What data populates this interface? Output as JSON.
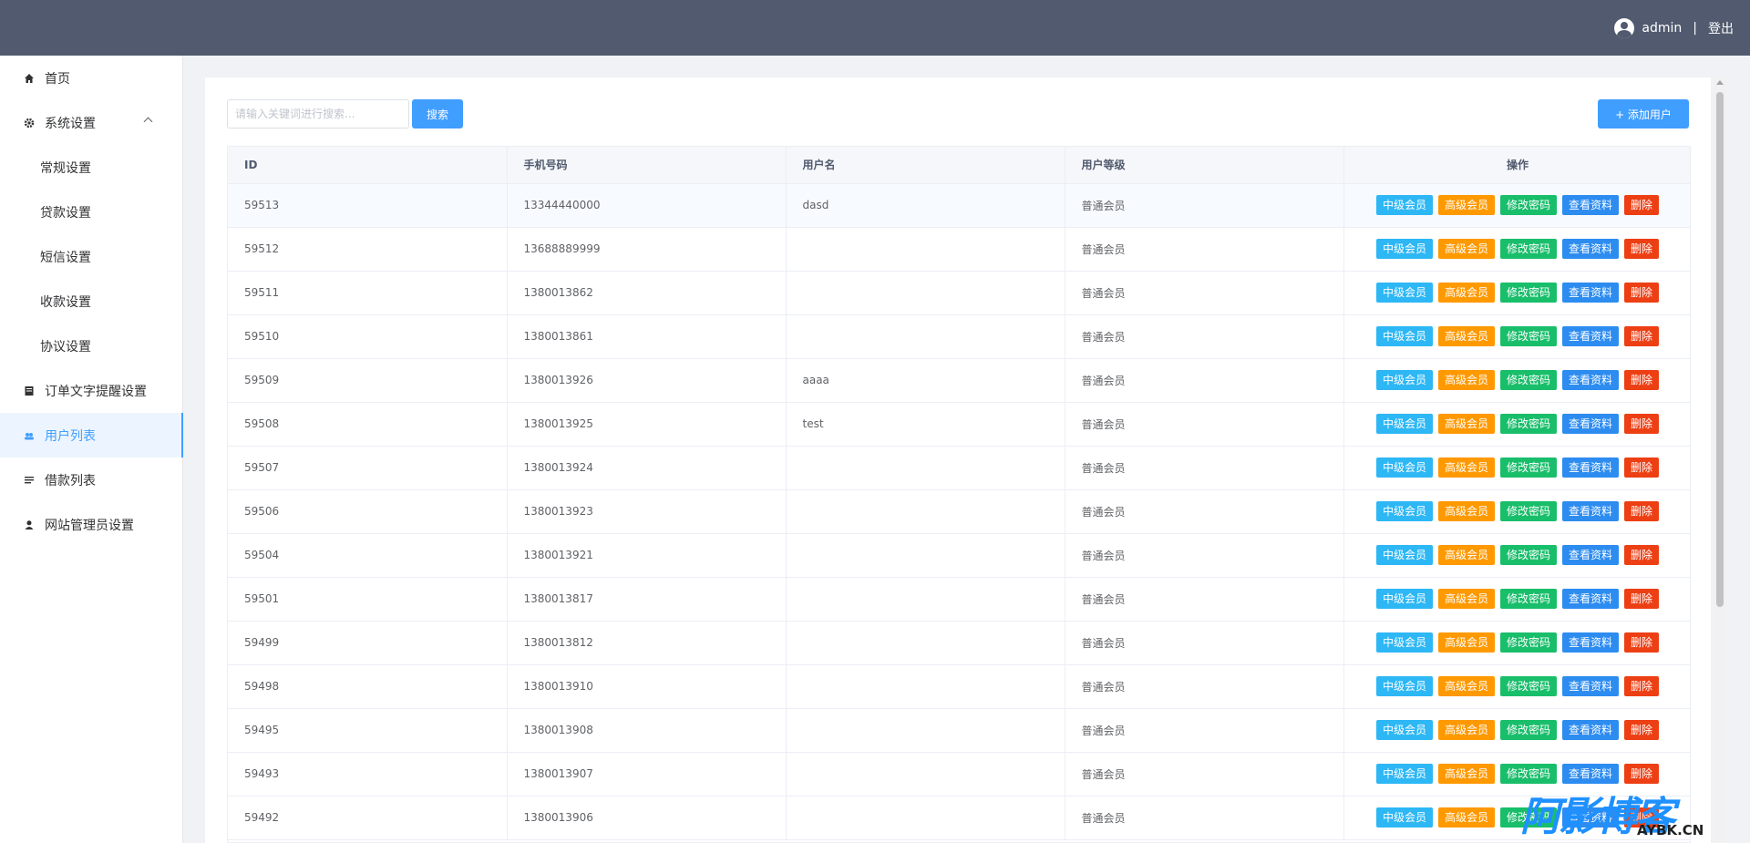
{
  "header": {
    "username": "admin",
    "separator": "|",
    "logout_label": "登出"
  },
  "sidebar": {
    "items": [
      {
        "label": "首页",
        "icon": "home-icon"
      },
      {
        "label": "系统设置",
        "icon": "gear-icon",
        "expanded": true
      },
      {
        "label": "常规设置"
      },
      {
        "label": "贷款设置"
      },
      {
        "label": "短信设置"
      },
      {
        "label": "收款设置"
      },
      {
        "label": "协议设置"
      },
      {
        "label": "订单文字提醒设置",
        "icon": "document-icon"
      },
      {
        "label": "用户列表",
        "icon": "users-icon",
        "active": true
      },
      {
        "label": "借款列表",
        "icon": "list-icon"
      },
      {
        "label": "网站管理员设置",
        "icon": "user-icon"
      }
    ]
  },
  "toolbar": {
    "search_placeholder": "请输入关键词进行搜索...",
    "search_label": "搜索",
    "add_user_label": "+  添加用户"
  },
  "table": {
    "columns": [
      "ID",
      "手机号码",
      "用户名",
      "用户等级",
      "操作"
    ],
    "actions": [
      "中级会员",
      "高级会员",
      "修改密码",
      "查看资料",
      "删除"
    ],
    "rows": [
      [
        "59513",
        "13344440000",
        "dasd",
        "普通会员"
      ],
      [
        "59512",
        "13688889999",
        "",
        "普通会员"
      ],
      [
        "59511",
        "1380013862",
        "",
        "普通会员"
      ],
      [
        "59510",
        "1380013861",
        "",
        "普通会员"
      ],
      [
        "59509",
        "1380013926",
        "aaaa",
        "普通会员"
      ],
      [
        "59508",
        "1380013925",
        "test",
        "普通会员"
      ],
      [
        "59507",
        "1380013924",
        "",
        "普通会员"
      ],
      [
        "59506",
        "1380013923",
        "",
        "普通会员"
      ],
      [
        "59504",
        "1380013921",
        "",
        "普通会员"
      ],
      [
        "59501",
        "1380013817",
        "",
        "普通会员"
      ],
      [
        "59499",
        "1380013812",
        "",
        "普通会员"
      ],
      [
        "59498",
        "1380013910",
        "",
        "普通会员"
      ],
      [
        "59495",
        "1380013908",
        "",
        "普通会员"
      ],
      [
        "59493",
        "1380013907",
        "",
        "普通会员"
      ],
      [
        "59492",
        "1380013906",
        "",
        "普通会员"
      ]
    ]
  },
  "watermark": {
    "main": "阿影博客",
    "sub": "AYBK.CN"
  },
  "colors": {
    "header_bg": "#515a6e",
    "accent": "#409eff",
    "mid_member": "#2db7f5",
    "high_member": "#ff9900",
    "change_password": "#19be6b",
    "view_profile": "#2d8cf0",
    "delete": "#ed3f14"
  }
}
